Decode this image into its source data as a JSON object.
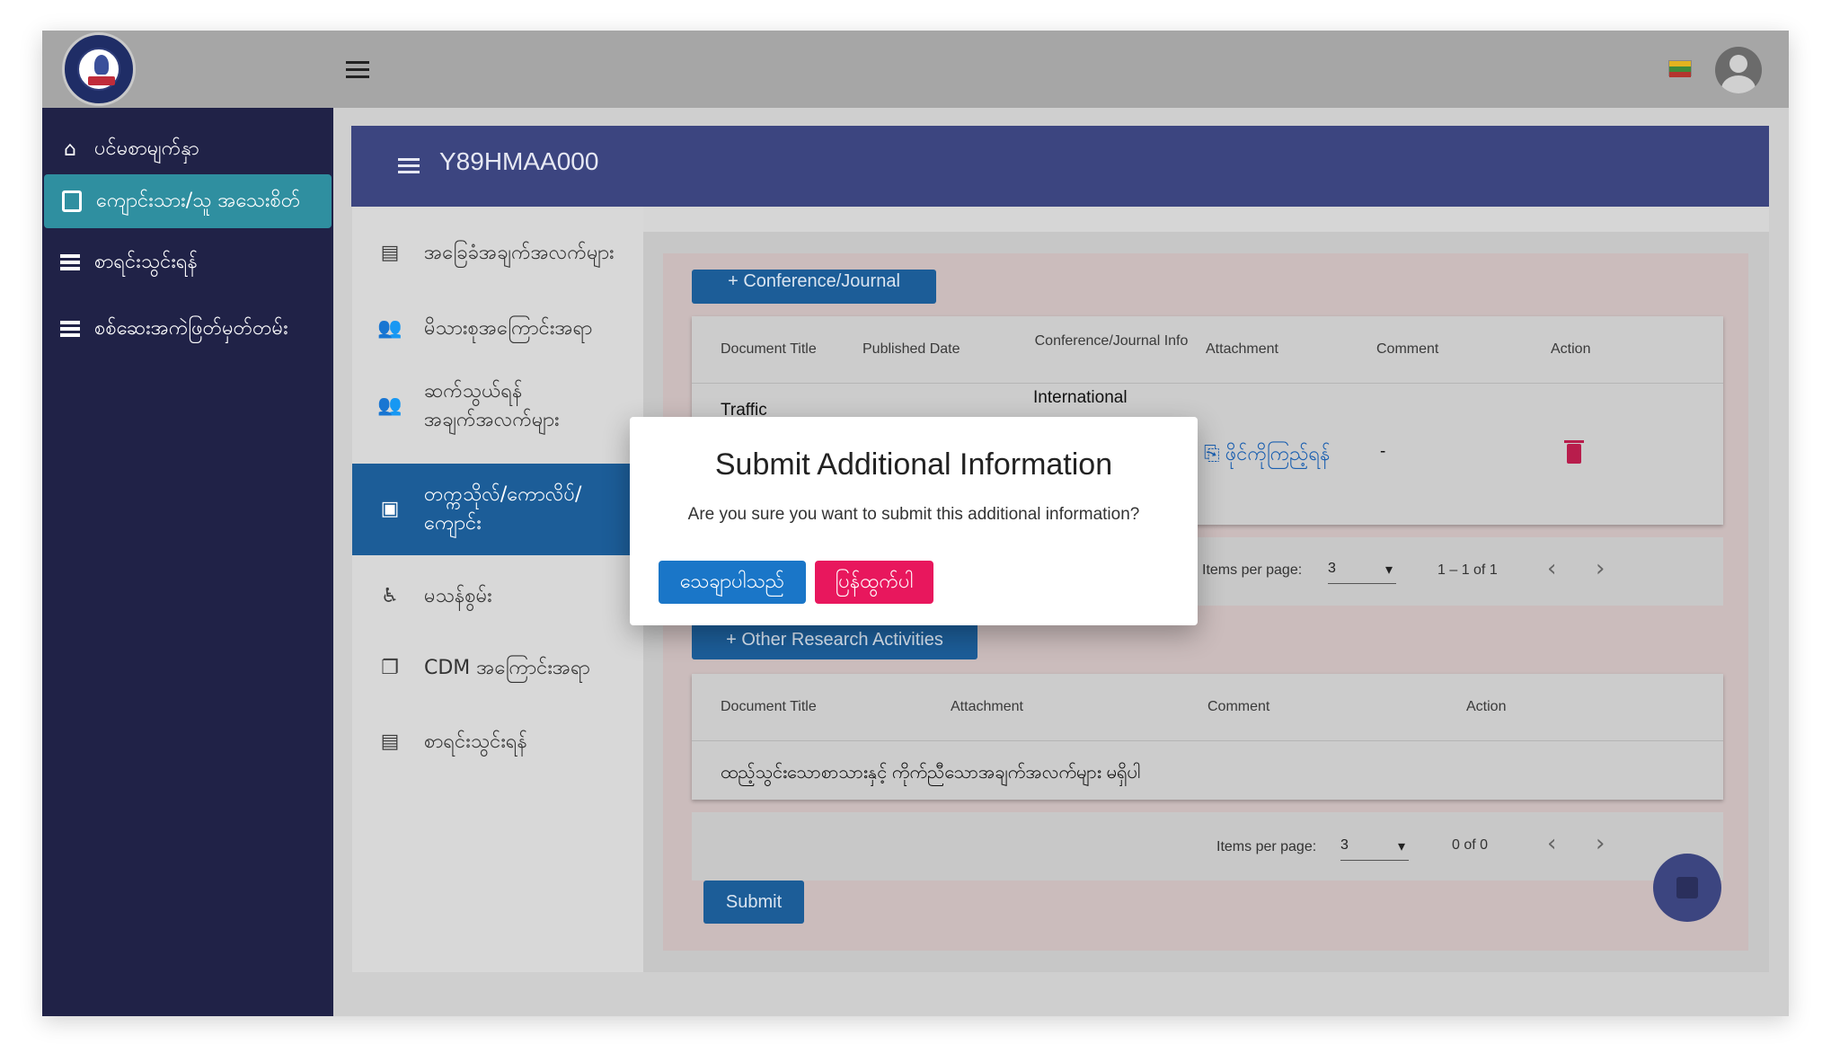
{
  "topbar": {
    "menu_icon": "menu-icon",
    "flag_icon": "myanmar-flag-icon",
    "avatar_icon": "user-avatar-icon"
  },
  "sidebar": {
    "items": [
      {
        "label": "ပင်မစာမျက်နှာ",
        "icon": "home-icon"
      },
      {
        "label": "ကျောင်းသား/သူ အသေးစိတ်",
        "icon": "document-icon"
      },
      {
        "label": "စာရင်းသွင်းရန်",
        "icon": "list-icon"
      },
      {
        "label": "စစ်ဆေးအကဲဖြတ်မှတ်တမ်း",
        "icon": "list-icon"
      }
    ]
  },
  "panel": {
    "title": "Y89HMAA000"
  },
  "tabs": [
    {
      "label": "အခြေခံအချက်အလက်များ",
      "icon": "list-alt-icon"
    },
    {
      "label": "မိသားစုအကြောင်းအရာ",
      "icon": "group-add-icon"
    },
    {
      "label": "ဆက်သွယ်ရန်အချက်အလက်များ",
      "icon": "group-add-icon"
    },
    {
      "label": "တက္ကသိုလ်/ကောလိပ်/ကျောင်း",
      "icon": "library-books-icon"
    },
    {
      "label": "မသန်စွမ်း",
      "icon": "accessible-icon"
    },
    {
      "label": "CDM အကြောင်းအရာ",
      "icon": "file-copy-icon"
    },
    {
      "label": "စာရင်းသွင်းရန်",
      "icon": "list-alt-icon"
    }
  ],
  "conference": {
    "add_button": "+ Conference/Journal",
    "headers": [
      "Document Title",
      "Published Date",
      "Conference/Journal Info",
      "Attachment",
      "Comment",
      "Action"
    ],
    "rows": [
      {
        "title": "Traffic",
        "published": "",
        "info": "International",
        "attachment": "ဖိုင်ကိုကြည့်ရန်",
        "comment": "-"
      }
    ],
    "items_per_page_label": "Items per page:",
    "items_per_page": "3",
    "range": "1 – 1 of 1"
  },
  "other": {
    "add_button": "+ Other Research Activities",
    "headers": [
      "Document Title",
      "Attachment",
      "Comment",
      "Action"
    ],
    "empty_message": "ထည့်သွင်းသောစာသားနှင့် ကိုက်ညီသောအချက်အလက်များ မရှိပါ",
    "items_per_page_label": "Items per page:",
    "items_per_page": "3",
    "range": "0 of 0"
  },
  "submit_button": "Submit",
  "modal": {
    "title": "Submit Additional Information",
    "message": "Are you sure you want to submit this additional information?",
    "confirm": "သေချာပါသည်",
    "cancel": "ပြန်ထွက်ပါ"
  },
  "colors": {
    "sidebar": "#202247",
    "header": "#3c4580",
    "active_tab": "#1c5d98",
    "confirm": "#1a76c8",
    "cancel": "#e8175d"
  }
}
